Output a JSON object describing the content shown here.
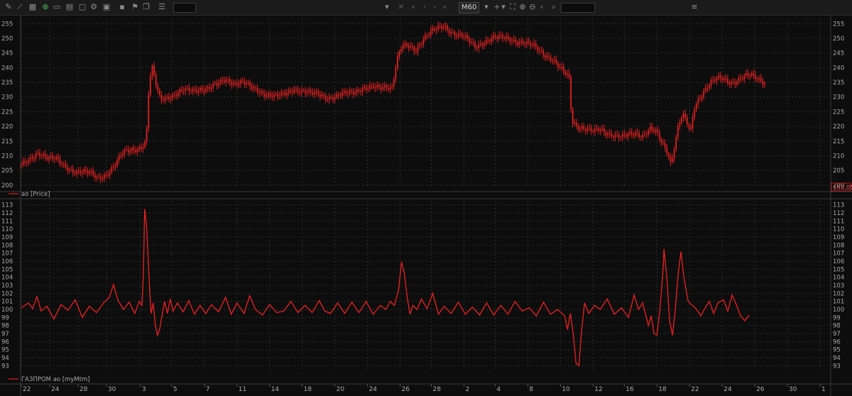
{
  "toolbar": {
    "timeframe": "M60",
    "icons": [
      "pencil-icon",
      "line-icon",
      "table-icon",
      "add-chart-icon",
      "window-icon",
      "window-icon",
      "window-icon",
      "settings-window-icon",
      "window-icon",
      "comment-icon",
      "flag-icon",
      "copy-icon",
      "list-icon",
      "field-icon",
      "dropdown-icon",
      "close-icon",
      "step-back-icon",
      "step-back-icon",
      "step-forward-icon",
      "step-forward-icon",
      "crosshair-icon",
      "chevron-down-icon",
      "fit-icon",
      "zoom-in-icon",
      "zoom-out-icon",
      "collapse-icon",
      "search-icon",
      "options-icon"
    ]
  },
  "colors": {
    "background": "#0d0d0d",
    "series": "#e02020",
    "grid": "#2e2e2e",
    "text": "#a8a8a8",
    "last_price_tag": "#c01818"
  },
  "chart_data": [
    {
      "type": "candlestick",
      "legend": "ao [Price]",
      "last_value_label": "168,05",
      "ylim": [
        199,
        257
      ],
      "yticks": [
        200,
        205,
        210,
        215,
        220,
        225,
        230,
        235,
        240,
        245,
        250,
        255
      ],
      "close_path": [
        [
          0,
          207
        ],
        [
          12,
          208
        ],
        [
          24,
          211
        ],
        [
          36,
          210
        ],
        [
          48,
          209
        ],
        [
          60,
          206
        ],
        [
          72,
          205
        ],
        [
          84,
          205
        ],
        [
          96,
          204
        ],
        [
          108,
          202
        ],
        [
          120,
          204
        ],
        [
          132,
          207
        ],
        [
          144,
          211
        ],
        [
          156,
          212
        ],
        [
          168,
          213
        ],
        [
          176,
          215
        ],
        [
          180,
          234
        ],
        [
          184,
          240
        ],
        [
          188,
          236
        ],
        [
          192,
          232
        ],
        [
          196,
          229
        ],
        [
          204,
          230
        ],
        [
          216,
          231
        ],
        [
          228,
          232
        ],
        [
          240,
          232
        ],
        [
          252,
          233
        ],
        [
          264,
          233
        ],
        [
          276,
          234
        ],
        [
          288,
          236
        ],
        [
          300,
          235
        ],
        [
          312,
          235
        ],
        [
          324,
          233
        ],
        [
          336,
          232
        ],
        [
          348,
          231
        ],
        [
          360,
          230
        ],
        [
          372,
          231
        ],
        [
          384,
          233
        ],
        [
          396,
          232
        ],
        [
          408,
          231
        ],
        [
          420,
          231
        ],
        [
          432,
          230
        ],
        [
          444,
          230
        ],
        [
          456,
          231
        ],
        [
          468,
          232
        ],
        [
          480,
          233
        ],
        [
          492,
          233
        ],
        [
          504,
          233
        ],
        [
          516,
          234
        ],
        [
          522,
          233
        ],
        [
          526,
          238
        ],
        [
          530,
          243
        ],
        [
          536,
          247
        ],
        [
          546,
          247
        ],
        [
          556,
          246
        ],
        [
          566,
          250
        ],
        [
          576,
          252
        ],
        [
          586,
          253
        ],
        [
          596,
          254
        ],
        [
          608,
          252
        ],
        [
          620,
          251
        ],
        [
          630,
          249
        ],
        [
          640,
          247
        ],
        [
          652,
          249
        ],
        [
          664,
          250
        ],
        [
          676,
          250
        ],
        [
          688,
          250
        ],
        [
          700,
          249
        ],
        [
          712,
          248
        ],
        [
          724,
          247
        ],
        [
          736,
          245
        ],
        [
          748,
          243
        ],
        [
          758,
          240
        ],
        [
          766,
          238
        ],
        [
          772,
          237
        ],
        [
          776,
          222
        ],
        [
          786,
          220
        ],
        [
          796,
          219
        ],
        [
          806,
          218
        ],
        [
          816,
          219
        ],
        [
          826,
          218
        ],
        [
          836,
          217
        ],
        [
          846,
          216
        ],
        [
          856,
          217
        ],
        [
          866,
          218
        ],
        [
          876,
          217
        ],
        [
          886,
          219
        ],
        [
          894,
          218
        ],
        [
          904,
          214
        ],
        [
          912,
          211
        ],
        [
          916,
          207
        ],
        [
          920,
          213
        ],
        [
          926,
          220
        ],
        [
          932,
          224
        ],
        [
          938,
          221
        ],
        [
          944,
          218
        ],
        [
          948,
          226
        ],
        [
          956,
          230
        ],
        [
          964,
          233
        ],
        [
          972,
          235
        ],
        [
          980,
          236
        ],
        [
          990,
          236
        ],
        [
          1000,
          235
        ],
        [
          1010,
          236
        ],
        [
          1020,
          237
        ],
        [
          1030,
          237
        ],
        [
          1040,
          236
        ],
        [
          1050,
          235
        ]
      ]
    },
    {
      "type": "line",
      "legend": "ГАЗПРОМ ao [myMtm]",
      "ylim": [
        92.5,
        113.5
      ],
      "yticks": [
        93,
        94,
        95,
        96,
        97,
        98,
        99,
        100,
        101,
        102,
        103,
        104,
        105,
        106,
        107,
        108,
        109,
        110,
        111,
        112,
        113
      ],
      "series": [
        {
          "points": [
            [
              0,
              100.2
            ],
            [
              10,
              100.8
            ],
            [
              16,
              100.1
            ],
            [
              22,
              101.6
            ],
            [
              28,
              99.8
            ],
            [
              36,
              100.4
            ],
            [
              46,
              98.8
            ],
            [
              56,
              100.6
            ],
            [
              66,
              99.9
            ],
            [
              76,
              101.2
            ],
            [
              86,
              99.0
            ],
            [
              96,
              100.4
            ],
            [
              106,
              99.6
            ],
            [
              116,
              100.8
            ],
            [
              124,
              101.5
            ],
            [
              130,
              103.1
            ],
            [
              136,
              101.2
            ],
            [
              144,
              100.0
            ],
            [
              152,
              100.9
            ],
            [
              160,
              99.5
            ],
            [
              166,
              101.0
            ],
            [
              170,
              100.5
            ],
            [
              172,
              104.0
            ],
            [
              174,
              112.5
            ],
            [
              177,
              110.0
            ],
            [
              180,
              104.0
            ],
            [
              183,
              99.5
            ],
            [
              186,
              100.8
            ],
            [
              189,
              98.0
            ],
            [
              192,
              96.8
            ],
            [
              195,
              97.5
            ],
            [
              198,
              99.0
            ],
            [
              202,
              101.0
            ],
            [
              206,
              99.5
            ],
            [
              210,
              101.3
            ],
            [
              214,
              99.8
            ],
            [
              220,
              100.8
            ],
            [
              228,
              99.7
            ],
            [
              236,
              101.1
            ],
            [
              244,
              99.4
            ],
            [
              252,
              100.5
            ],
            [
              260,
              99.5
            ],
            [
              268,
              100.6
            ],
            [
              278,
              99.7
            ],
            [
              288,
              101.5
            ],
            [
              296,
              99.4
            ],
            [
              304,
              100.8
            ],
            [
              314,
              99.5
            ],
            [
              322,
              101.7
            ],
            [
              330,
              100.0
            ],
            [
              340,
              99.3
            ],
            [
              350,
              100.6
            ],
            [
              360,
              99.6
            ],
            [
              370,
              99.8
            ],
            [
              380,
              101.0
            ],
            [
              390,
              99.6
            ],
            [
              400,
              100.5
            ],
            [
              410,
              99.6
            ],
            [
              420,
              101.1
            ],
            [
              428,
              99.8
            ],
            [
              436,
              99.5
            ],
            [
              446,
              100.8
            ],
            [
              456,
              99.5
            ],
            [
              466,
              100.9
            ],
            [
              476,
              99.6
            ],
            [
              486,
              101.0
            ],
            [
              496,
              99.4
            ],
            [
              506,
              100.5
            ],
            [
              514,
              100.0
            ],
            [
              520,
              101.0
            ],
            [
              526,
              100.5
            ],
            [
              532,
              102.5
            ],
            [
              536,
              105.9
            ],
            [
              540,
              104.5
            ],
            [
              544,
              101.5
            ],
            [
              548,
              99.4
            ],
            [
              552,
              100.5
            ],
            [
              558,
              100.0
            ],
            [
              564,
              101.3
            ],
            [
              572,
              100.1
            ],
            [
              580,
              102.0
            ],
            [
              588,
              99.4
            ],
            [
              596,
              100.4
            ],
            [
              606,
              99.5
            ],
            [
              616,
              100.9
            ],
            [
              626,
              99.4
            ],
            [
              636,
              100.3
            ],
            [
              646,
              99.3
            ],
            [
              656,
              100.8
            ],
            [
              666,
              99.3
            ],
            [
              676,
              100.5
            ],
            [
              686,
              99.4
            ],
            [
              696,
              101.0
            ],
            [
              706,
              99.8
            ],
            [
              716,
              100.2
            ],
            [
              726,
              99.2
            ],
            [
              736,
              100.9
            ],
            [
              746,
              99.4
            ],
            [
              756,
              100.0
            ],
            [
              766,
              99.2
            ],
            [
              770,
              97.5
            ],
            [
              774,
              99.5
            ],
            [
              778,
              97.0
            ],
            [
              782,
              93.3
            ],
            [
              786,
              93.0
            ],
            [
              790,
              97.5
            ],
            [
              794,
              100.8
            ],
            [
              800,
              99.5
            ],
            [
              808,
              100.5
            ],
            [
              816,
              100.0
            ],
            [
              826,
              101.3
            ],
            [
              836,
              99.4
            ],
            [
              846,
              100.2
            ],
            [
              856,
              99.0
            ],
            [
              864,
              101.8
            ],
            [
              870,
              100.0
            ],
            [
              876,
              100.8
            ],
            [
              884,
              98.0
            ],
            [
              888,
              99.2
            ],
            [
              892,
              97.0
            ],
            [
              896,
              96.8
            ],
            [
              900,
              99.8
            ],
            [
              904,
              104.0
            ],
            [
              906,
              107.5
            ],
            [
              910,
              104.0
            ],
            [
              914,
              98.5
            ],
            [
              918,
              96.8
            ],
            [
              922,
              100.0
            ],
            [
              926,
              104.5
            ],
            [
              930,
              107.2
            ],
            [
              934,
              104.0
            ],
            [
              940,
              101.0
            ],
            [
              946,
              100.5
            ],
            [
              952,
              100.0
            ],
            [
              958,
              99.2
            ],
            [
              964,
              100.2
            ],
            [
              970,
              101.0
            ],
            [
              976,
              99.5
            ],
            [
              982,
              100.8
            ],
            [
              990,
              101.2
            ],
            [
              996,
              99.8
            ],
            [
              1002,
              101.8
            ],
            [
              1008,
              100.6
            ],
            [
              1014,
              99.2
            ],
            [
              1020,
              98.6
            ],
            [
              1026,
              99.3
            ]
          ]
        }
      ]
    }
  ],
  "x_axis": {
    "labels": [
      {
        "label": "22",
        "pos": 0
      },
      {
        "label": "24",
        "pos": 40
      },
      {
        "label": "28",
        "pos": 80
      },
      {
        "label": "30",
        "pos": 120
      },
      {
        "label": "3",
        "pos": 168
      },
      {
        "label": "5",
        "pos": 212
      },
      {
        "label": "7",
        "pos": 258
      },
      {
        "label": "11",
        "pos": 304
      },
      {
        "label": "14",
        "pos": 350
      },
      {
        "label": "18",
        "pos": 396
      },
      {
        "label": "20",
        "pos": 442
      },
      {
        "label": "24",
        "pos": 488
      },
      {
        "label": "26",
        "pos": 534
      },
      {
        "label": "28",
        "pos": 578
      },
      {
        "label": "2",
        "pos": 624
      },
      {
        "label": "4",
        "pos": 668
      },
      {
        "label": "8",
        "pos": 714
      },
      {
        "label": "10",
        "pos": 760
      },
      {
        "label": "12",
        "pos": 806
      },
      {
        "label": "16",
        "pos": 850
      },
      {
        "label": "18",
        "pos": 896
      },
      {
        "label": "22",
        "pos": 942
      },
      {
        "label": "24",
        "pos": 988
      },
      {
        "label": "26",
        "pos": 1034
      },
      {
        "label": "30",
        "pos": 1080
      },
      {
        "label": "1",
        "pos": 1126
      }
    ]
  }
}
